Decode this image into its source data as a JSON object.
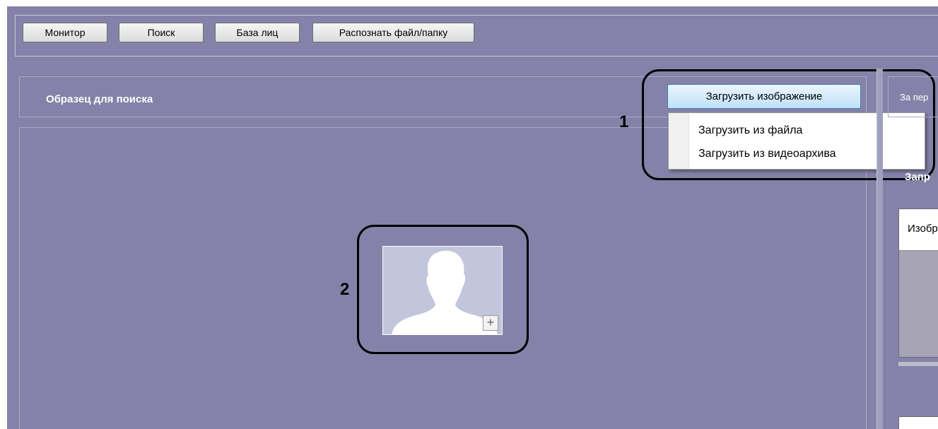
{
  "toolbar": {
    "buttons": [
      {
        "label": "Монитор"
      },
      {
        "label": "Поиск"
      },
      {
        "label": "База лиц"
      },
      {
        "label": "Распознать файл/папку"
      }
    ]
  },
  "sample_panel": {
    "title": "Образец для поиска",
    "load_button_label": "Загрузить изображение",
    "load_menu": [
      {
        "label": "Загрузить из файла"
      },
      {
        "label": "Загрузить из видеоархива"
      }
    ],
    "photo_placeholder_icon": "user-silhouette-icon",
    "add_icon": "plus-icon"
  },
  "annotations": {
    "marker_1": "1",
    "marker_2": "2"
  },
  "right_panel": {
    "header_text": "За пер",
    "sub_title": "Запр",
    "table_header": "Изобр"
  },
  "colors": {
    "background": "#8582a9",
    "button_highlight": "#bfe1f7",
    "photo_bg": "#c1c6dd"
  }
}
